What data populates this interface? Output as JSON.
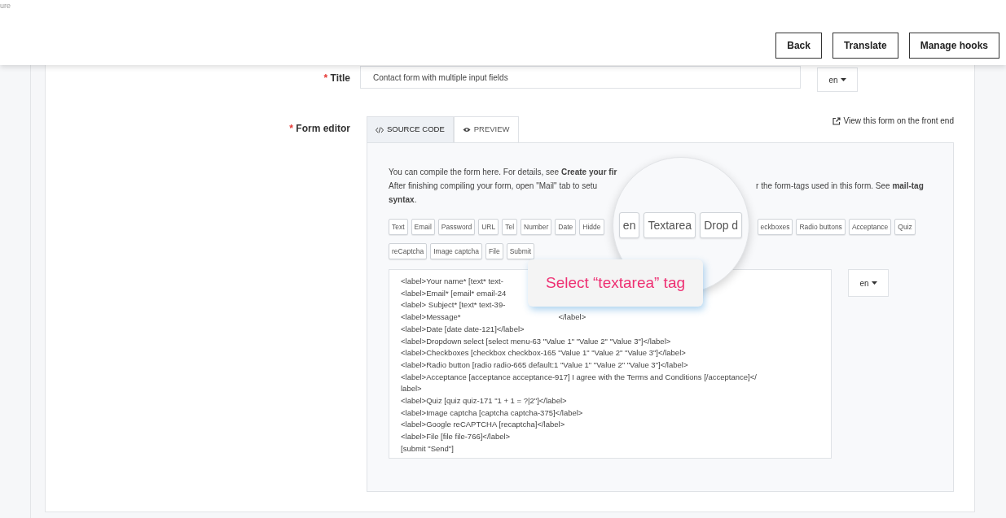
{
  "corner_text": "ure",
  "header_buttons": [
    "Back",
    "Translate",
    "Manage hooks"
  ],
  "title_field": {
    "label": "Title",
    "required_mark": "*",
    "value": "Contact form with multiple input fields",
    "lang": "en"
  },
  "form_editor": {
    "label": "Form editor",
    "required_mark": "*",
    "tabs": [
      {
        "label": "SOURCE CODE",
        "selected": true
      },
      {
        "label": "PREVIEW",
        "selected": false
      }
    ],
    "front_end_link": "View this form on the front end",
    "intro_line_1": "You can compile the form here. For details, see **Create your fir**",
    "intro_line_2_left": "After finishing compiling your form, open \"Mail\" tab to setu",
    "intro_line_2_right": "r the form-tags used in this form. See **mail-tag**",
    "intro_line_3": "**syntax**.",
    "tags_row_1_left": [
      "Text",
      "Email",
      "Password",
      "URL",
      "Tel",
      "Number",
      "Date",
      "Hidde"
    ],
    "tags_row_1_right": [
      "eckboxes",
      "Radio buttons",
      "Acceptance",
      "Quiz"
    ],
    "tags_row_2": [
      "reCaptcha",
      "Image captcha",
      "File",
      "Submit"
    ],
    "code_lines": [
      [
        "<label>Your name* [text* text-"
      ],
      [
        "<label>Email* [email* email-24"
      ],
      [
        "<label> Subject* [text* text-39-"
      ],
      [
        "<label>Message*",
        "</label>"
      ],
      [
        "<label>Date [date date-121]</label>"
      ],
      [
        "<label>Dropdown select [select menu-63 \"Value 1\" \"Value 2\" \"Value 3\"]</label>"
      ],
      [
        "<label>Checkboxes [checkbox checkbox-165 \"Value 1\" \"Value 2\" \"Value 3\"]</label>"
      ],
      [
        "<label>Radio button [radio radio-665 default:1 \"Value 1\" \"Value 2\" \"Value 3\"]</label>"
      ],
      [
        "<label>Acceptance [acceptance acceptance-917] I agree with the Terms and Conditions [/acceptance]</"
      ],
      [
        "label>"
      ],
      [
        "<label>Quiz [quiz quiz-171 \"1 + 1 = ?|2\"]</label>"
      ],
      [
        "<label>Image captcha [captcha captcha-375]</label>"
      ],
      [
        "<label>Google reCAPTCHA [recaptcha]</label>"
      ],
      [
        "<label>File [file file-766]</label>"
      ],
      [
        "[submit \"Send\"]"
      ]
    ],
    "code_lang": "en",
    "magnifier": {
      "tags": [
        "en",
        "Textarea",
        "Drop d"
      ]
    },
    "tooltip": {
      "text": "Select “textarea” tag"
    }
  }
}
